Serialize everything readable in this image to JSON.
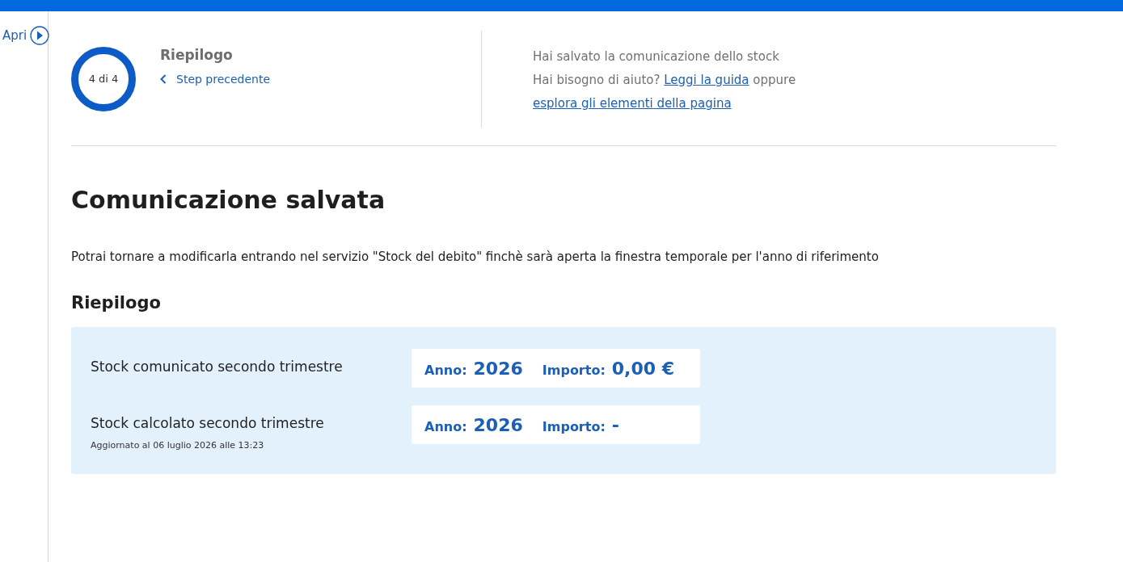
{
  "sidebar": {
    "toggle_label": "Apri"
  },
  "stepper": {
    "progress": "4 di 4",
    "title": "Riepilogo",
    "back_link": "Step precedente"
  },
  "help": {
    "saved_message": "Hai salvato la comunicazione dello stock",
    "question": "Hai bisogno di aiuto?",
    "guide_link": "Leggi la guida",
    "connector": "oppure",
    "explore_link": "esplora gli elementi della pagina"
  },
  "heading": "Comunicazione salvata",
  "description": "Potrai tornare a modificarla entrando nel servizio \"Stock del debito\" finchè sarà aperta la finestra temporale per l'anno di riferimento",
  "summary": {
    "title": "Riepilogo",
    "rows": [
      {
        "label": "Stock comunicato secondo trimestre",
        "year_label": "Anno:",
        "year": "2026",
        "amount_label": "Importo:",
        "amount": "0,00 €"
      },
      {
        "label": "Stock calcolato secondo trimestre",
        "note": "Aggiornato al 06 luglio 2026 alle 13:23",
        "year_label": "Anno:",
        "year": "2026",
        "amount_label": "Importo:",
        "amount": "-"
      }
    ]
  }
}
